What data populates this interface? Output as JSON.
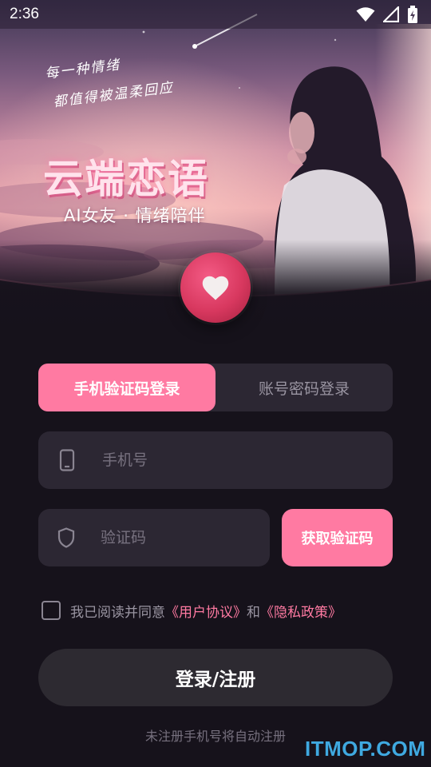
{
  "status_bar": {
    "time": "2:36"
  },
  "hero": {
    "tagline_line1": "每一种情绪",
    "tagline_line2": "都值得被温柔回应",
    "app_title": "云端恋语",
    "app_subtitle": "AI女友 · 情绪陪伴"
  },
  "login_tabs": [
    {
      "label": "手机验证码登录",
      "active": true
    },
    {
      "label": "账号密码登录",
      "active": false
    }
  ],
  "phone_field": {
    "placeholder": "手机号",
    "value": ""
  },
  "code_field": {
    "placeholder": "验证码",
    "value": ""
  },
  "get_code_button": "获取验证码",
  "agreement": {
    "checked": false,
    "prefix": "我已阅读并同意",
    "user_agreement": "《用户协议》",
    "and": "和",
    "privacy_policy": "《隐私政策》"
  },
  "login_button": "登录/注册",
  "footer_note": "未注册手机号将自动注册",
  "watermark": "ITMOP.COM",
  "colors": {
    "accent": "#ff7aa2",
    "background": "#16121b",
    "field_bg": "#2c2733",
    "heart_badge": "#d8385f"
  },
  "icons": [
    "wifi-icon",
    "signal-icon",
    "battery-icon",
    "heart-icon",
    "phone-icon",
    "shield-icon"
  ]
}
